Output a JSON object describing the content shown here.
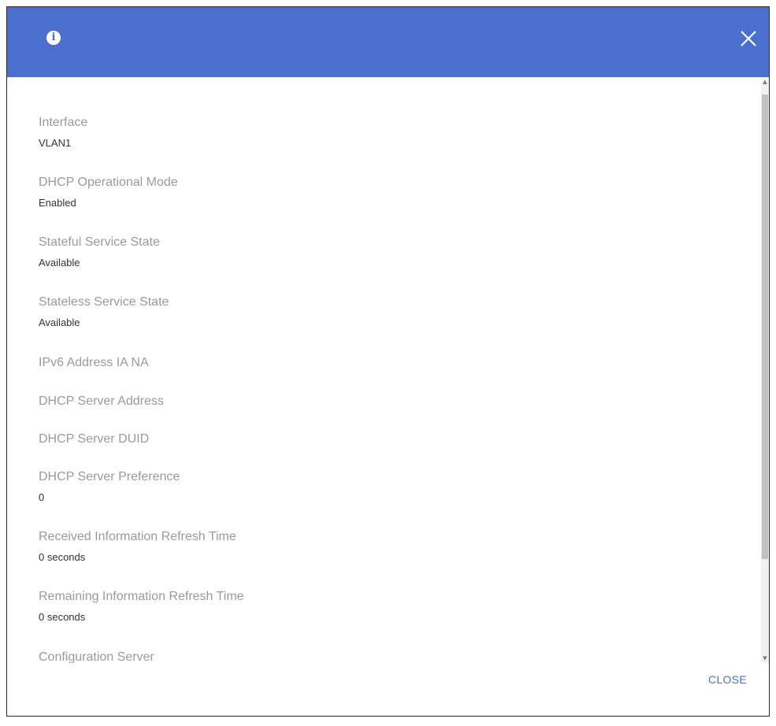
{
  "dialog": {
    "info_icon": "info-icon",
    "close_icon": "close-icon",
    "close_label": "CLOSE",
    "header_color": "#4a6fcf"
  },
  "fields": [
    {
      "label": "Interface",
      "value": "VLAN1"
    },
    {
      "label": "DHCP Operational Mode",
      "value": "Enabled"
    },
    {
      "label": "Stateful Service State",
      "value": "Available"
    },
    {
      "label": "Stateless Service State",
      "value": "Available"
    },
    {
      "label": "IPv6 Address IA NA",
      "value": ""
    },
    {
      "label": "DHCP Server Address",
      "value": ""
    },
    {
      "label": "DHCP Server DUID",
      "value": ""
    },
    {
      "label": "DHCP Server Preference",
      "value": "0"
    },
    {
      "label": "Received Information Refresh Time",
      "value": "0 seconds"
    },
    {
      "label": "Remaining Information Refresh Time",
      "value": "0 seconds"
    },
    {
      "label": "Configuration Server",
      "value": ""
    }
  ]
}
